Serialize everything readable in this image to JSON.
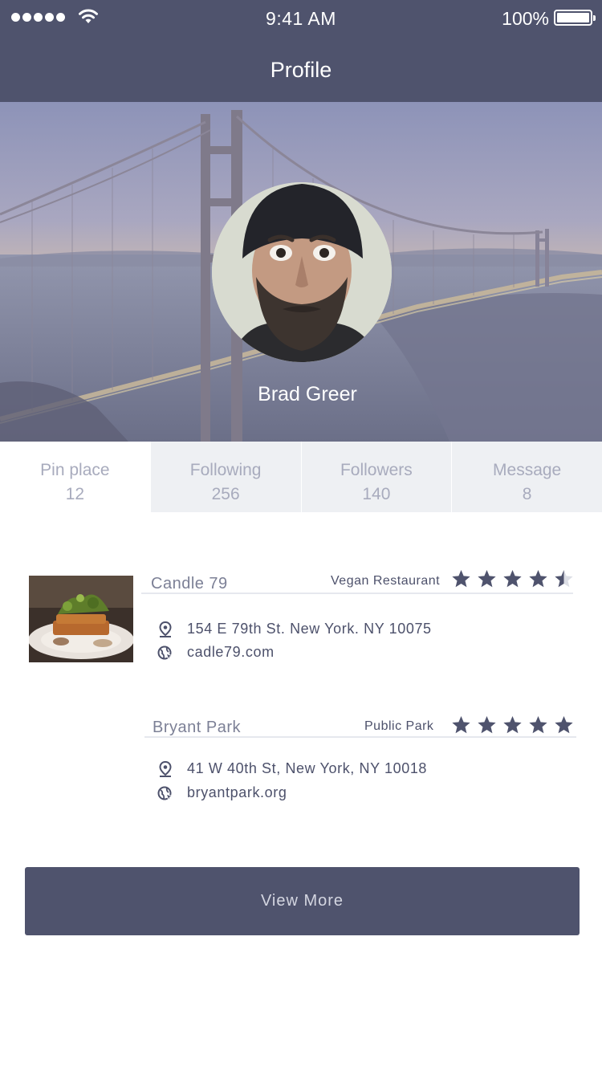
{
  "status_bar": {
    "time": "9:41 AM",
    "battery": "100%",
    "signal_icon": "signal-dots-icon",
    "wifi_icon": "wifi-icon",
    "battery_icon": "battery-icon"
  },
  "header": {
    "title": "Profile"
  },
  "profile": {
    "name": "Brad Greer"
  },
  "stats": [
    {
      "label": "Pin place",
      "count": "12"
    },
    {
      "label": "Following",
      "count": "256"
    },
    {
      "label": "Followers",
      "count": "140"
    },
    {
      "label": "Message",
      "count": "8"
    }
  ],
  "places": [
    {
      "name": "Candle 79",
      "category": "Vegan Restaurant",
      "rating": 4.5,
      "address": "154 E 79th St. New York. NY 10075",
      "website": "cadle79.com"
    },
    {
      "name": "Bryant Park",
      "category": "Public Park",
      "rating": 5,
      "address": "41 W 40th St, New York, NY 10018",
      "website": "bryantpark.org"
    }
  ],
  "actions": {
    "view_more": "View More"
  },
  "colors": {
    "primary": "#4f536d",
    "tab_bg": "#eef0f3",
    "muted_text": "#a8abbd",
    "star": "#4f536d",
    "star_empty": "#dcdee5"
  }
}
